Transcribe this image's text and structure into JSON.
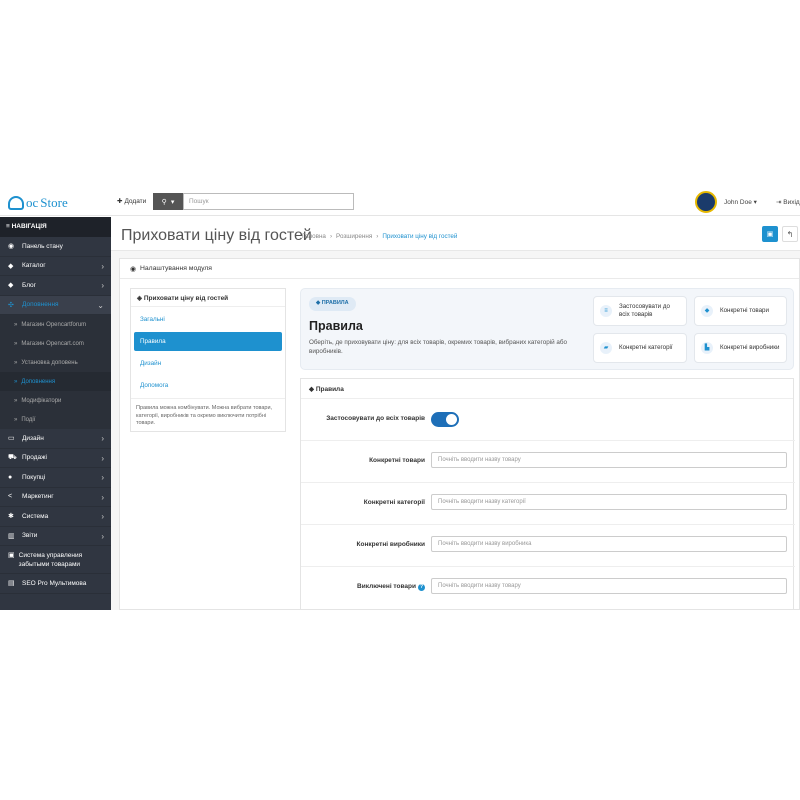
{
  "header": {
    "logo_oc": "oc",
    "logo_store": "Store",
    "add_label": "Додати",
    "search_placeholder": "Пошук",
    "username": "John Doe",
    "logout_label": "Вихід"
  },
  "sidebar": {
    "title": "НАВІГАЦІЯ",
    "items": [
      {
        "label": "Панель стану",
        "icon": "dashboard-icon"
      },
      {
        "label": "Каталог",
        "icon": "tag-icon"
      },
      {
        "label": "Блог",
        "icon": "tag-icon"
      },
      {
        "label": "Доповнення",
        "icon": "puzzle-icon"
      },
      {
        "label": "Дизайн",
        "icon": "monitor-icon"
      },
      {
        "label": "Продажі",
        "icon": "cart-icon"
      },
      {
        "label": "Покупці",
        "icon": "user-icon"
      },
      {
        "label": "Маркетинг",
        "icon": "share-icon"
      },
      {
        "label": "Система",
        "icon": "cog-icon"
      },
      {
        "label": "Звіти",
        "icon": "bar-chart-icon"
      },
      {
        "label": "Система управления забытыми товарами",
        "icon": "lock-icon"
      },
      {
        "label": "SEO Pro Мультимова",
        "icon": "file-icon"
      }
    ],
    "subitems": [
      {
        "label": "Магазин Opencartforum"
      },
      {
        "label": "Магазин Opencart.com"
      },
      {
        "label": "Установка доповень"
      },
      {
        "label": "Доповнення"
      },
      {
        "label": "Модифікатори"
      },
      {
        "label": "Події"
      }
    ]
  },
  "page": {
    "title": "Приховати ціну від гостей",
    "breadcrumb": [
      "Головна",
      "Розширення",
      "Приховати ціну від гостей"
    ]
  },
  "panel": {
    "title": "Налаштування модуля",
    "leftnav": {
      "title": "Приховати ціну від гостей",
      "items": [
        "Загальні",
        "Правила",
        "Дизайн",
        "Допомога"
      ],
      "active": "Правила",
      "note": "Правила можна комбінувати. Можна вибрати товари, категорії, виробників та окремо виключити потрібні товари."
    },
    "hero": {
      "badge": "ПРАВИЛА",
      "title": "Правила",
      "description": "Оберіть, де приховувати ціну: для всіх товарів, окремих товарів, вибраних категорій або виробників.",
      "cards": [
        {
          "label": "Застосовувати до всіх товарів",
          "icon": "list-icon"
        },
        {
          "label": "Конкретні товари",
          "icon": "tag-icon"
        },
        {
          "label": "Конкретні категорії",
          "icon": "folder-icon"
        },
        {
          "label": "Конкретні виробники",
          "icon": "factory-icon"
        }
      ]
    },
    "rules": {
      "title": "Правила",
      "apply_all_label": "Застосовувати до всіх товарів",
      "apply_all_value": true,
      "fields": [
        {
          "label": "Конкретні товари",
          "placeholder": "Почніть вводити назву товару"
        },
        {
          "label": "Конкретні категорії",
          "placeholder": "Почніть вводити назву категорії"
        },
        {
          "label": "Конкретні виробники",
          "placeholder": "Почніть вводити назву виробника"
        },
        {
          "label": "Виключені товари",
          "placeholder": "Почніть вводити назву товару"
        }
      ]
    }
  },
  "colors": {
    "accent": "#1e91cf",
    "sidebar_bg": "#303641",
    "toggle_on": "#1e6fb8"
  }
}
